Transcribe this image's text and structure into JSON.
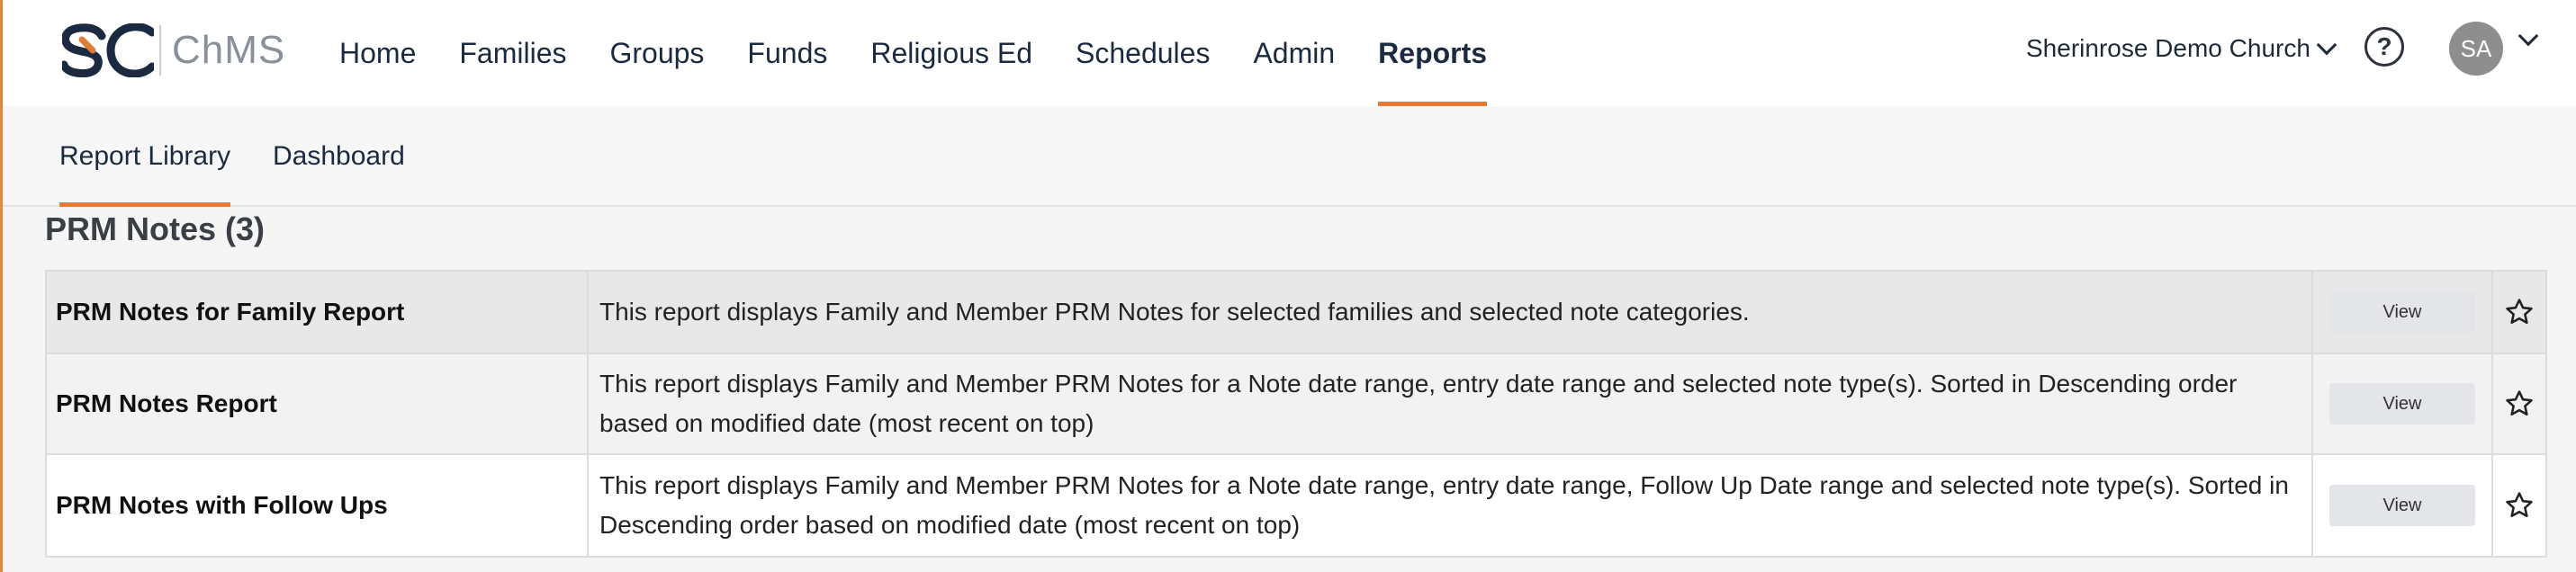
{
  "brand": {
    "name": "ChMS",
    "logo_icon": "sc-logo-icon"
  },
  "nav": {
    "items": [
      {
        "label": "Home"
      },
      {
        "label": "Families"
      },
      {
        "label": "Groups"
      },
      {
        "label": "Funds"
      },
      {
        "label": "Religious Ed"
      },
      {
        "label": "Schedules"
      },
      {
        "label": "Admin"
      },
      {
        "label": "Reports",
        "active": true
      }
    ]
  },
  "account": {
    "church": "Sherinrose Demo Church",
    "help_icon": "?",
    "avatar_initials": "SA"
  },
  "subnav": {
    "tabs": [
      {
        "label": "Report Library",
        "active": true
      },
      {
        "label": "Dashboard"
      }
    ]
  },
  "section": {
    "title": "PRM Notes (3)"
  },
  "reports": [
    {
      "name": "PRM Notes for Family Report",
      "description": "This report displays Family and Member PRM Notes for selected families and selected note categories.",
      "view_label": "View"
    },
    {
      "name": "PRM Notes Report",
      "description": "This report displays Family and Member PRM Notes for a Note date range, entry date range and selected note type(s). Sorted in Descending order based on modified date (most recent on top)",
      "view_label": "View"
    },
    {
      "name": "PRM Notes with Follow Ups",
      "description": "This report displays Family and Member PRM Notes for a Note date range, entry date range, Follow Up Date range and selected note type(s). Sorted in Descending order based on modified date (most recent on top)",
      "view_label": "View"
    }
  ],
  "colors": {
    "accent": "#e07b39",
    "navy": "#1b2a41"
  }
}
